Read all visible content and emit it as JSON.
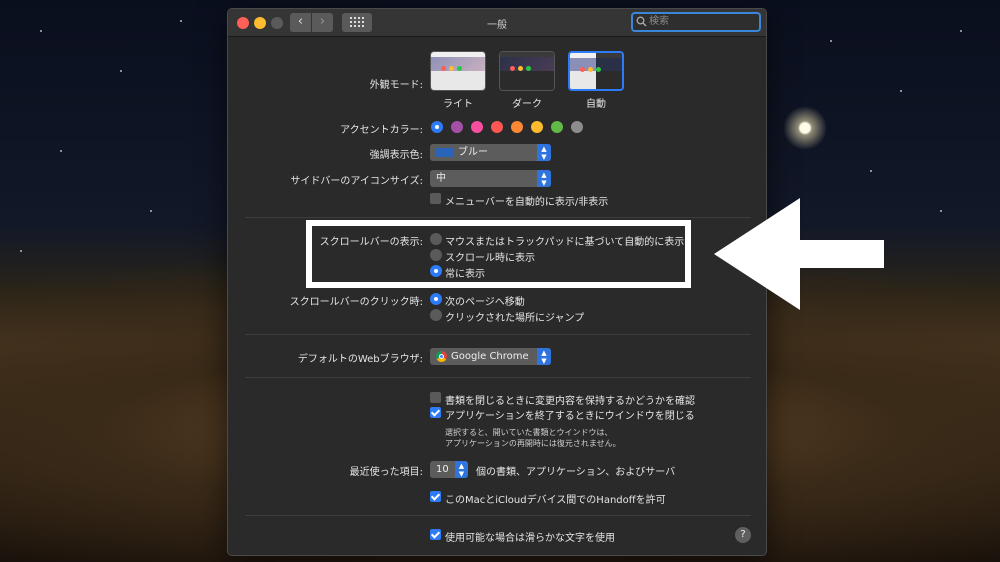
{
  "window": {
    "title": "一般"
  },
  "search": {
    "placeholder": "検索",
    "icon": "magnifier"
  },
  "appearance": {
    "label": "外観モード:",
    "options": [
      {
        "label": "ライト",
        "selected": false
      },
      {
        "label": "ダーク",
        "selected": false
      },
      {
        "label": "自動",
        "selected": true
      }
    ]
  },
  "accent": {
    "label": "アクセントカラー:",
    "colors": [
      "#2d7bf6",
      "#a550a7",
      "#f74f9e",
      "#fc5753",
      "#fc8835",
      "#fdba2c",
      "#62ba46",
      "#8c8c8c"
    ],
    "selected_index": 0
  },
  "highlight": {
    "label": "強調表示色:",
    "value": "ブルー",
    "swatch_color": "#2a64b8"
  },
  "sidebar_icon_size": {
    "label": "サイドバーのアイコンサイズ:",
    "value": "中"
  },
  "menubar": {
    "label": "メニューバーを自動的に表示/非表示",
    "checked": false
  },
  "scrollbars": {
    "label": "スクロールバーの表示:",
    "options": [
      {
        "label": "マウスまたはトラックパッドに基づいて自動的に表示",
        "selected": false
      },
      {
        "label": "スクロール時に表示",
        "selected": false
      },
      {
        "label": "常に表示",
        "selected": true
      }
    ]
  },
  "scroll_click": {
    "label": "スクロールバーのクリック時:",
    "options": [
      {
        "label": "次のページへ移動",
        "selected": true
      },
      {
        "label": "クリックされた場所にジャンプ",
        "selected": false
      }
    ]
  },
  "browser": {
    "label": "デフォルトのWebブラウザ:",
    "value": "Google Chrome"
  },
  "doc_options": {
    "ask_keep_changes": {
      "label": "書類を閉じるときに変更内容を保持するかどうかを確認",
      "checked": false
    },
    "close_windows": {
      "label": "アプリケーションを終了するときにウインドウを閉じる",
      "checked": true
    },
    "note_line1": "選択すると、開いていた書類とウインドウは、",
    "note_line2": "アプリケーションの再開時には復元されません。"
  },
  "recent_items": {
    "label": "最近使った項目:",
    "value": "10",
    "suffix": "個の書類、アプリケーション、およびサーバ"
  },
  "handoff": {
    "label": "このMacとiCloudデバイス間でのHandoffを許可",
    "checked": true
  },
  "font_smoothing": {
    "label": "使用可能な場合は滑らかな文字を使用",
    "checked": true
  },
  "help_button": "?"
}
